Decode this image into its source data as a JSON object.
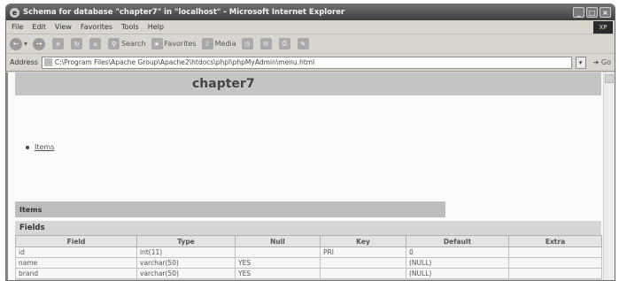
{
  "window": {
    "title": "Schema for database \"chapter7\" in \"localhost\" - Microsoft Internet Explorer",
    "logo": "XP"
  },
  "menu": [
    "File",
    "Edit",
    "View",
    "Favorites",
    "Tools",
    "Help"
  ],
  "toolbar": {
    "back": "←",
    "forward": "→",
    "search": "Search",
    "favorites": "Favorites",
    "media": "Media"
  },
  "address": {
    "label": "Address",
    "url": "C:\\Program Files\\Apache Group\\Apache2\\htdocs\\phpl\\phpMyAdmin\\menu.html",
    "go": "Go"
  },
  "page": {
    "title": "chapter7",
    "tables": [
      "Items"
    ],
    "table_name": "Items",
    "fields_heading": "Fields"
  },
  "fields_table": {
    "columns": [
      "Field",
      "Type",
      "Null",
      "Key",
      "Default",
      "Extra"
    ],
    "rows": [
      [
        "id",
        "int(11)",
        "",
        "PRI",
        "0",
        ""
      ],
      [
        "name",
        "varchar(50)",
        "YES",
        "",
        "(NULL)",
        ""
      ],
      [
        "brand",
        "varchar(50)",
        "YES",
        "",
        "(NULL)",
        ""
      ]
    ]
  }
}
